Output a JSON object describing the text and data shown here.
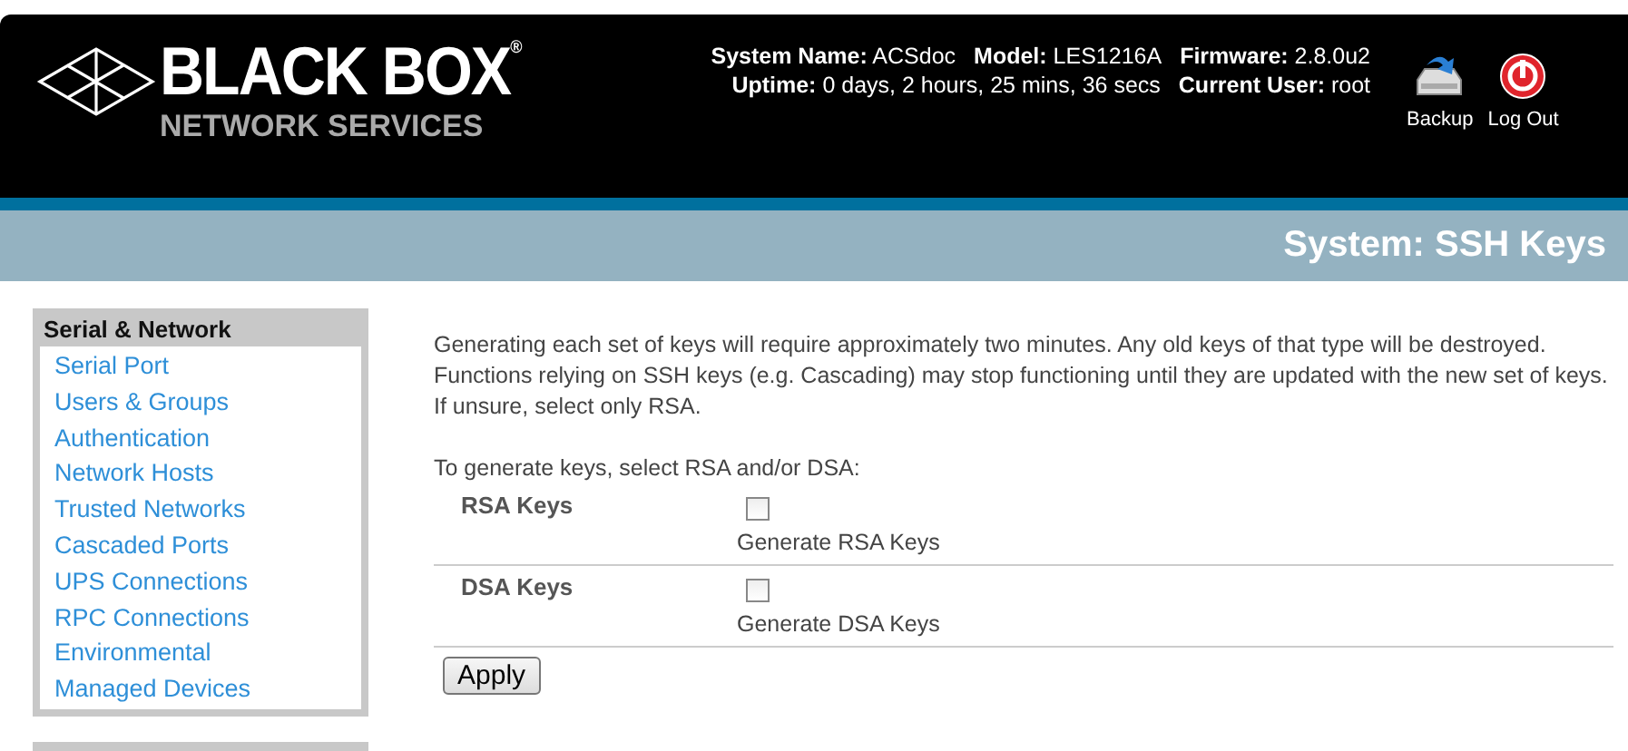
{
  "logo": {
    "name": "BLACK BOX$^{®}$",
    "tagline": "NETWORK SERVICES"
  },
  "system_info": [
    [
      {
        "label": "System Name:",
        "value": "ACSdoc"
      },
      {
        "label": "Model:",
        "value": "LES1216A"
      },
      {
        "label": "Firmware:",
        "value": "2.8.0u2"
      }
    ],
    [
      {
        "label": "Uptime:",
        "value": "0 days, 2 hours, 25 mins, 36 secs"
      },
      {
        "label": "Current User:",
        "value": "root"
      }
    ]
  ],
  "header_actions": [
    {
      "kind": "backup",
      "label": "Backup"
    },
    {
      "kind": "logout",
      "label": "Log Out"
    }
  ],
  "page_title": "System: SSH Keys",
  "sidebar": {
    "heading": "Serial & Network",
    "items": [
      "Serial Port",
      "Users & Groups",
      "Authentication",
      "Network Hosts",
      "Trusted Networks",
      "Cascaded Ports",
      "UPS Connections",
      "RPC Connections",
      "Environmental",
      "Managed Devices"
    ]
  },
  "intro": "Generating each set of keys will require approximately two minutes. Any old keys of that type will be destroyed. Functions relying on SSH keys (e.g. Cascading) may stop functioning until they are updated with the new set of keys. If unsure, select only RSA.",
  "prompt": "To generate keys, select RSA and/or DSA:",
  "key_rows": [
    {
      "label": "RSA Keys",
      "checkbox_label": "Generate RSA Keys",
      "checked": false
    },
    {
      "label": "DSA Keys",
      "checkbox_label": "Generate DSA Keys",
      "checked": false
    }
  ],
  "apply_button": "Apply"
}
